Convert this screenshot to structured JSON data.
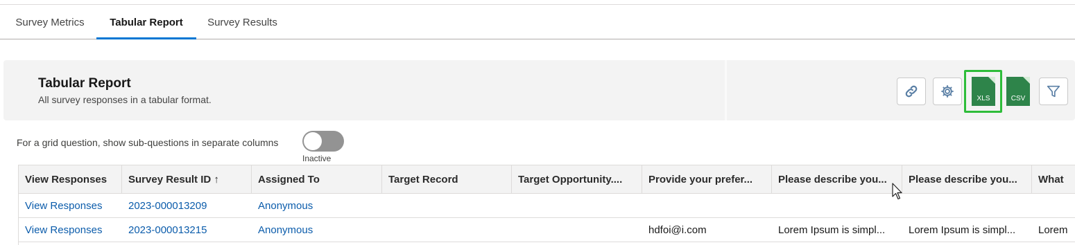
{
  "tabs": [
    {
      "label": "Survey Metrics"
    },
    {
      "label": "Tabular Report",
      "active": true
    },
    {
      "label": "Survey Results"
    }
  ],
  "header": {
    "title": "Tabular Report",
    "subtitle": "All survey responses in a tabular format.",
    "actions": {
      "link_icon": "link-icon",
      "settings_icon": "gear-icon",
      "xls_label": "XLS",
      "csv_label": "CSV",
      "filter_icon": "filter-icon"
    }
  },
  "grid_toggle": {
    "label": "For a grid question, show sub-questions in separate columns",
    "state": "Inactive",
    "checked": false
  },
  "table": {
    "columns": [
      "View Responses",
      "Survey Result ID ↑",
      "Assigned To",
      "Target Record",
      "Target Opportunity....",
      "Provide your prefer...",
      "Please describe you...",
      "Please describe you...",
      "What"
    ],
    "rows": [
      [
        "View Responses",
        "2023-000013209",
        "Anonymous",
        "",
        "",
        "",
        "",
        "",
        ""
      ],
      [
        "View Responses",
        "2023-000013215",
        "Anonymous",
        "",
        "",
        "hdfoi@i.com",
        "Lorem Ipsum is simpl...",
        "Lorem Ipsum is simpl...",
        "Lorem"
      ]
    ]
  },
  "colors": {
    "accent": "#0176d3",
    "link": "#0b5cab",
    "file_green": "#2e844a",
    "highlight": "#2ebd3a",
    "toggle_off": "#939393"
  }
}
